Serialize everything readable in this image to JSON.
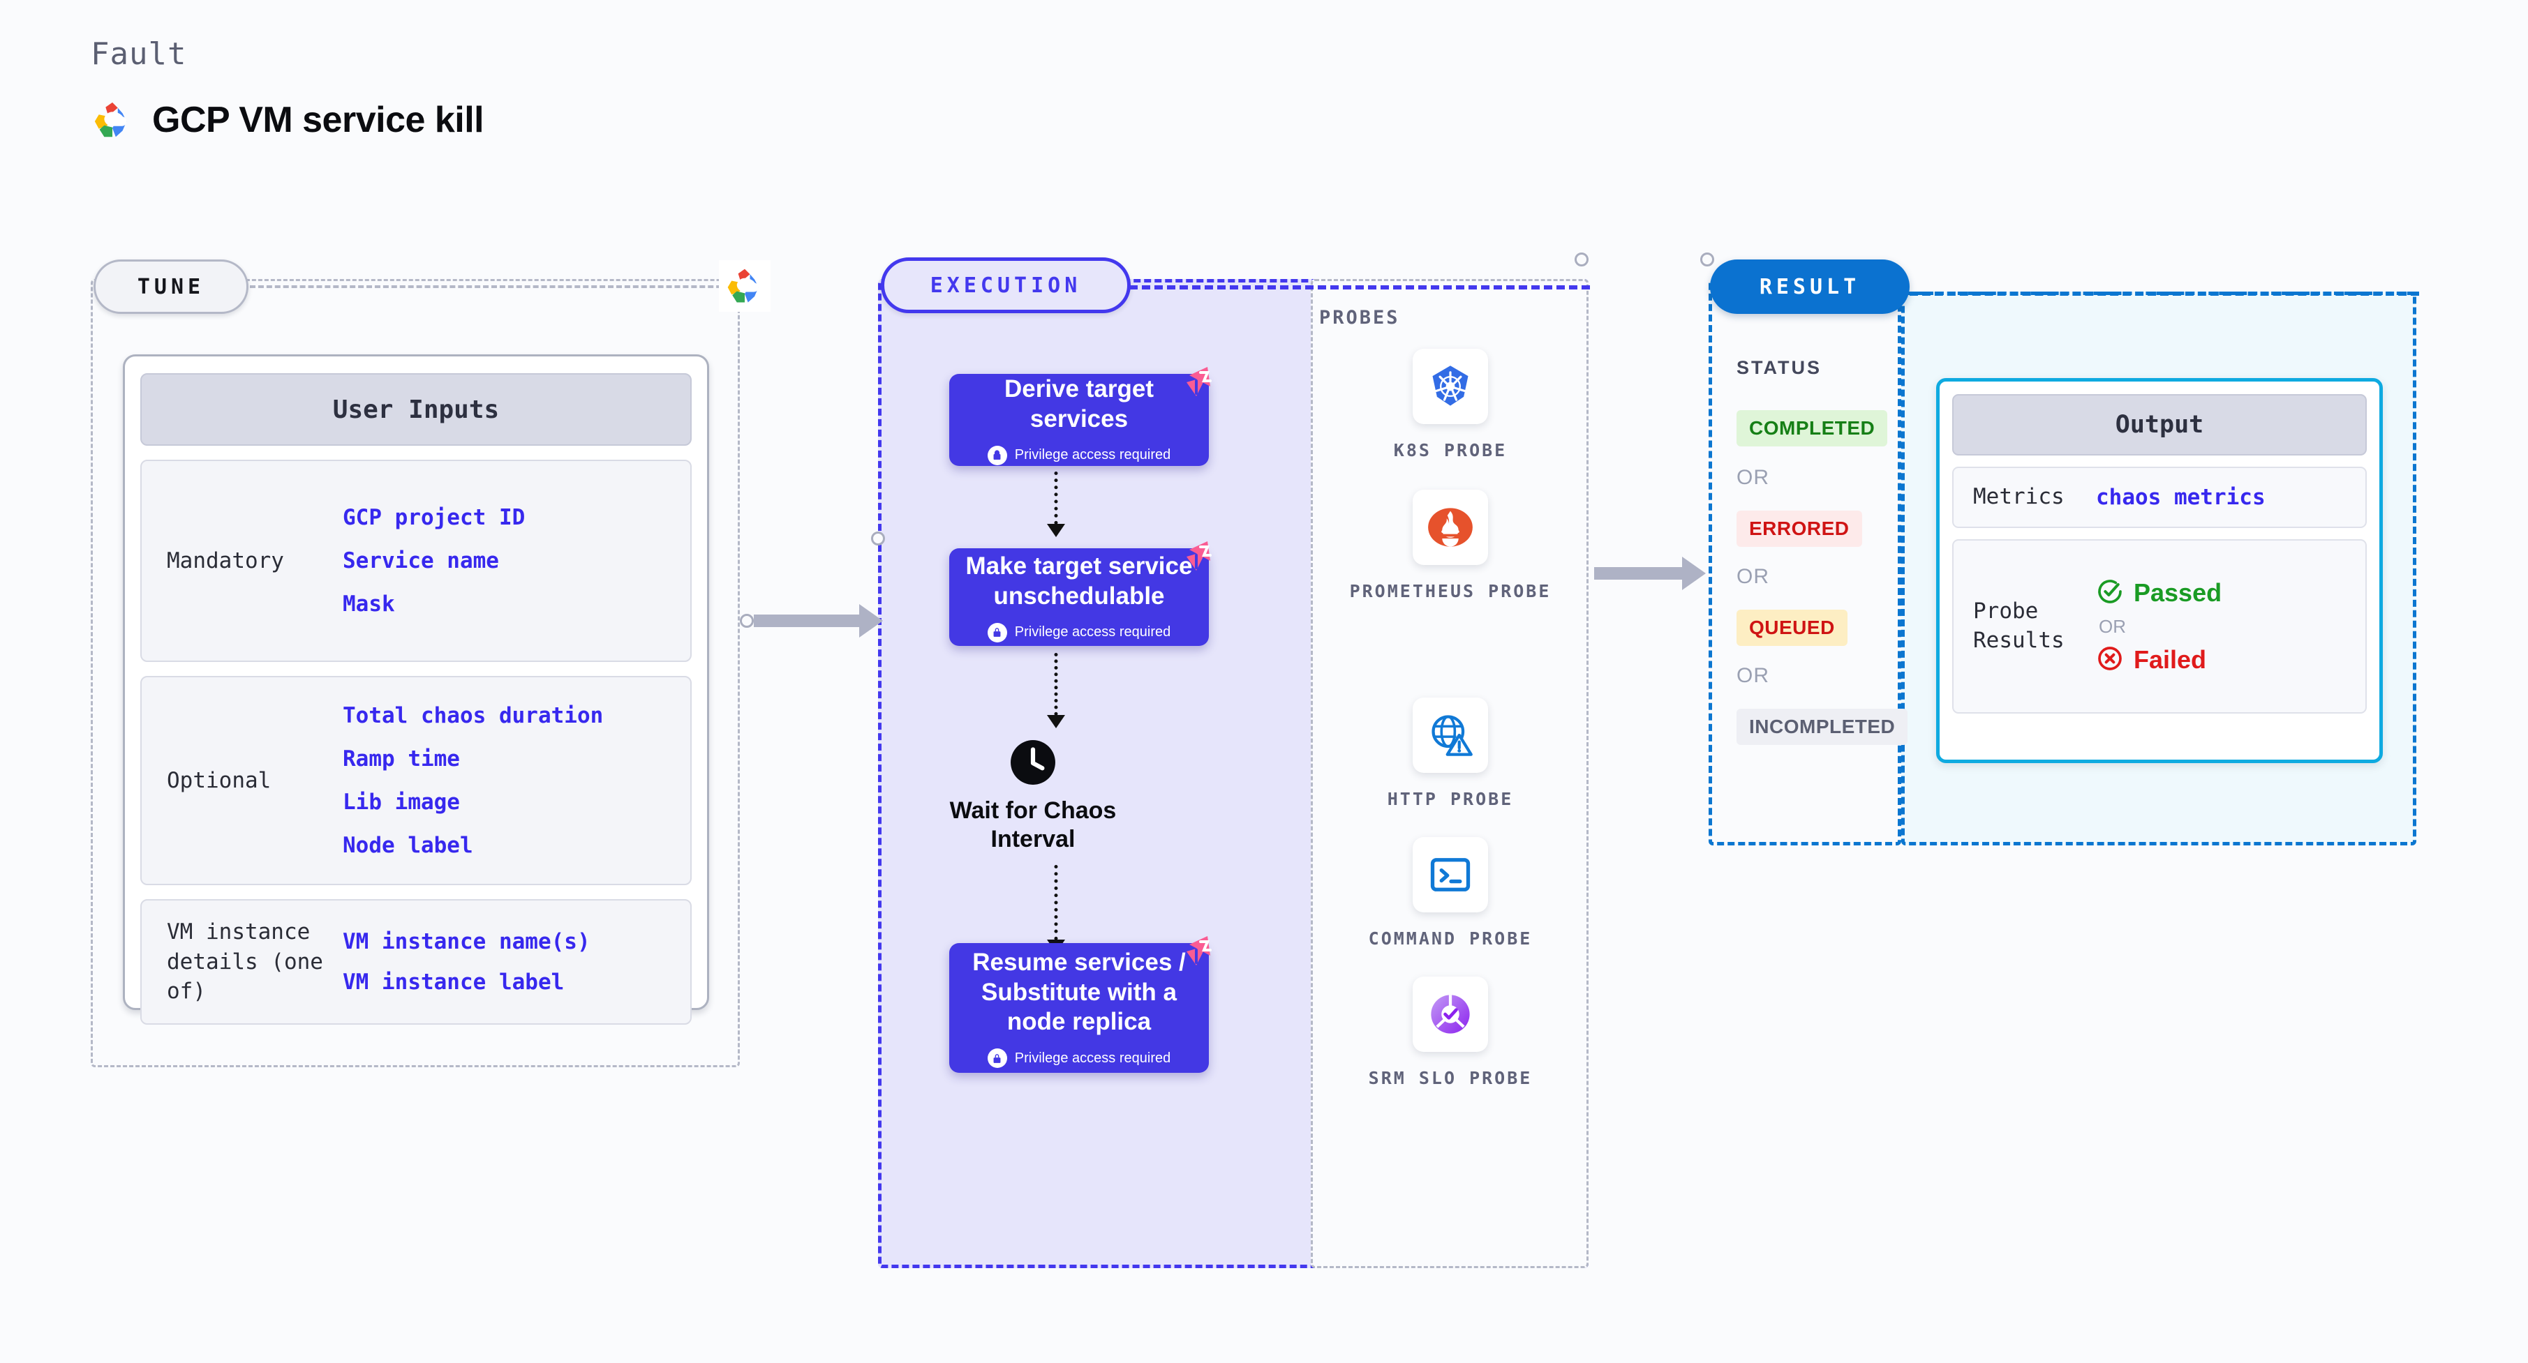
{
  "header": {
    "eyebrow": "Fault",
    "title": "GCP VM service kill",
    "logo_icon": "gcp-logo-icon"
  },
  "tune": {
    "pill_label": "TUNE",
    "badge_icon": "gcp-logo-icon",
    "card_title": "User Inputs",
    "groups": [
      {
        "key": "Mandatory",
        "values": [
          "GCP project ID",
          "Service name",
          "Mask"
        ]
      },
      {
        "key": "Optional",
        "values": [
          "Total chaos duration",
          "Ramp time",
          "Lib image",
          "Node label"
        ]
      },
      {
        "key": "VM instance details (one of)",
        "values": [
          "VM instance name(s)",
          "VM instance label"
        ]
      }
    ]
  },
  "execution": {
    "pill_label": "EXECUTION",
    "privilege_note": "Privilege access required",
    "nodes": [
      {
        "title": "Derive target services",
        "privileged": true,
        "ribbon_icon": "chaos-ribbon-icon"
      },
      {
        "title": "Make target service unschedulable",
        "privileged": true,
        "ribbon_icon": "chaos-ribbon-icon"
      },
      {
        "title": "Resume services / Substitute with a node replica",
        "privileged": true,
        "ribbon_icon": "chaos-ribbon-icon"
      }
    ],
    "wait_node": {
      "label": "Wait for Chaos Interval",
      "icon": "clock-icon"
    }
  },
  "probes": {
    "title": "PROBES",
    "items": [
      {
        "label": "K8S PROBE",
        "icon": "kubernetes-icon"
      },
      {
        "label": "PROMETHEUS PROBE",
        "icon": "prometheus-icon"
      },
      {
        "label": "HTTP PROBE",
        "icon": "http-globe-warning-icon"
      },
      {
        "label": "COMMAND PROBE",
        "icon": "terminal-icon"
      },
      {
        "label": "SRM SLO PROBE",
        "icon": "srm-slo-icon"
      }
    ]
  },
  "result": {
    "pill_label": "RESULT",
    "status_title": "STATUS",
    "or_label": "OR",
    "statuses": [
      {
        "label": "COMPLETED",
        "text_color": "#167f16",
        "bg_color": "#dff5d8"
      },
      {
        "label": "ERRORED",
        "text_color": "#cf1414",
        "bg_color": "#fdeaea"
      },
      {
        "label": "QUEUED",
        "text_color": "#cf1414",
        "bg_color": "#fdeec3"
      },
      {
        "label": "INCOMPLETED",
        "text_color": "#5b5f72",
        "bg_color": "#eeeff4"
      }
    ],
    "output": {
      "card_title": "Output",
      "metrics_key": "Metrics",
      "metrics_value": "chaos metrics",
      "probe_key": "Probe Results",
      "passed_label": "Passed",
      "failed_label": "Failed",
      "or_label": "OR",
      "passed_icon": "check-circle-icon",
      "failed_icon": "x-circle-icon",
      "passed_color": "#1a9b24",
      "failed_color": "#e01b1b"
    }
  },
  "colors": {
    "execution_purple": "#4338ee",
    "result_blue": "#0b72d0",
    "output_cyan": "#0eaae0",
    "link_blue": "#3728ee",
    "ribbon_pink": "#fa5c93"
  }
}
